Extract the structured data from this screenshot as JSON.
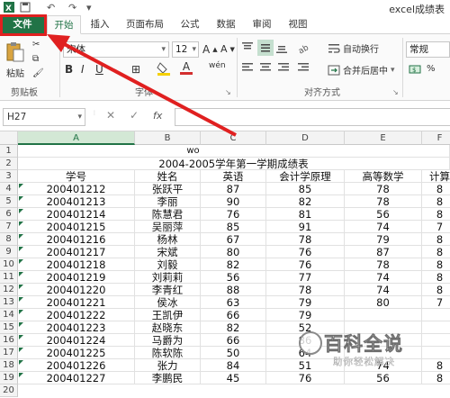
{
  "window": {
    "title": "excel成绩表"
  },
  "ribbon_tabs": [
    "文件",
    "开始",
    "插入",
    "页面布局",
    "公式",
    "数据",
    "审阅",
    "视图"
  ],
  "ribbon": {
    "clipboard": {
      "paste_label": "粘贴",
      "group_label": "剪贴板"
    },
    "font": {
      "name": "宋体",
      "size": "12",
      "bold": "B",
      "italic": "I",
      "underline": "U",
      "group_label": "字体",
      "font_color_glyph": "A",
      "wen": "wén"
    },
    "alignment": {
      "wrap_text": "自动换行",
      "merge_center": "合并后居中",
      "group_label": "对齐方式"
    },
    "number": {
      "format": "常规"
    },
    "colors": {
      "excel_green": "#217346",
      "annotation_red": "#e02020",
      "font_color_red": "#d32f2f",
      "fill_yellow": "#f5d000"
    }
  },
  "formula_bar": {
    "name_box": "H27",
    "cancel_glyph": "✕",
    "enter_glyph": "✓",
    "fx_label": "fx",
    "formula": ""
  },
  "sheet": {
    "columns": [
      "A",
      "B",
      "C",
      "D",
      "E",
      "F"
    ],
    "selected_column": "A",
    "row_numbers": [
      "1",
      "2",
      "3",
      "4",
      "5",
      "6",
      "7",
      "8",
      "9",
      "10",
      "11",
      "12",
      "13",
      "14",
      "15",
      "16",
      "17",
      "18",
      "19",
      "20"
    ],
    "row1_text": "wo",
    "title": "2004-2005学年第一学期成绩表",
    "headers": [
      "学号",
      "姓名",
      "英语",
      "会计学原理",
      "高等数学",
      "计算"
    ],
    "rows": [
      [
        "200401212",
        "张跃平",
        "87",
        "85",
        "78",
        "8"
      ],
      [
        "200401213",
        "李丽",
        "90",
        "82",
        "78",
        "8"
      ],
      [
        "200401214",
        "陈慧君",
        "76",
        "81",
        "56",
        "8"
      ],
      [
        "200401215",
        "吴丽萍",
        "85",
        "91",
        "74",
        "7"
      ],
      [
        "200401216",
        "杨林",
        "67",
        "78",
        "79",
        "8"
      ],
      [
        "200401217",
        "宋斌",
        "80",
        "76",
        "87",
        "8"
      ],
      [
        "200401218",
        "刘毅",
        "82",
        "76",
        "78",
        "8"
      ],
      [
        "200401219",
        "刘莉莉",
        "56",
        "77",
        "74",
        "8"
      ],
      [
        "200401220",
        "李青红",
        "88",
        "78",
        "74",
        "8"
      ],
      [
        "200401221",
        "侯冰",
        "63",
        "79",
        "80",
        "7"
      ],
      [
        "200401222",
        "王凯伊",
        "66",
        "79",
        "",
        ""
      ],
      [
        "200401223",
        "赵晓东",
        "82",
        "52",
        "",
        ""
      ],
      [
        "200401224",
        "马爵为",
        "66",
        "86",
        "",
        ""
      ],
      [
        "200401225",
        "陈软陈",
        "50",
        "64",
        "",
        ""
      ],
      [
        "200401226",
        "张力",
        "84",
        "51",
        "74",
        "8"
      ],
      [
        "200401227",
        "李鹏民",
        "45",
        "76",
        "56",
        "8"
      ]
    ]
  },
  "watermark": {
    "line1": "百科全说",
    "line2": "助你轻松解决"
  }
}
